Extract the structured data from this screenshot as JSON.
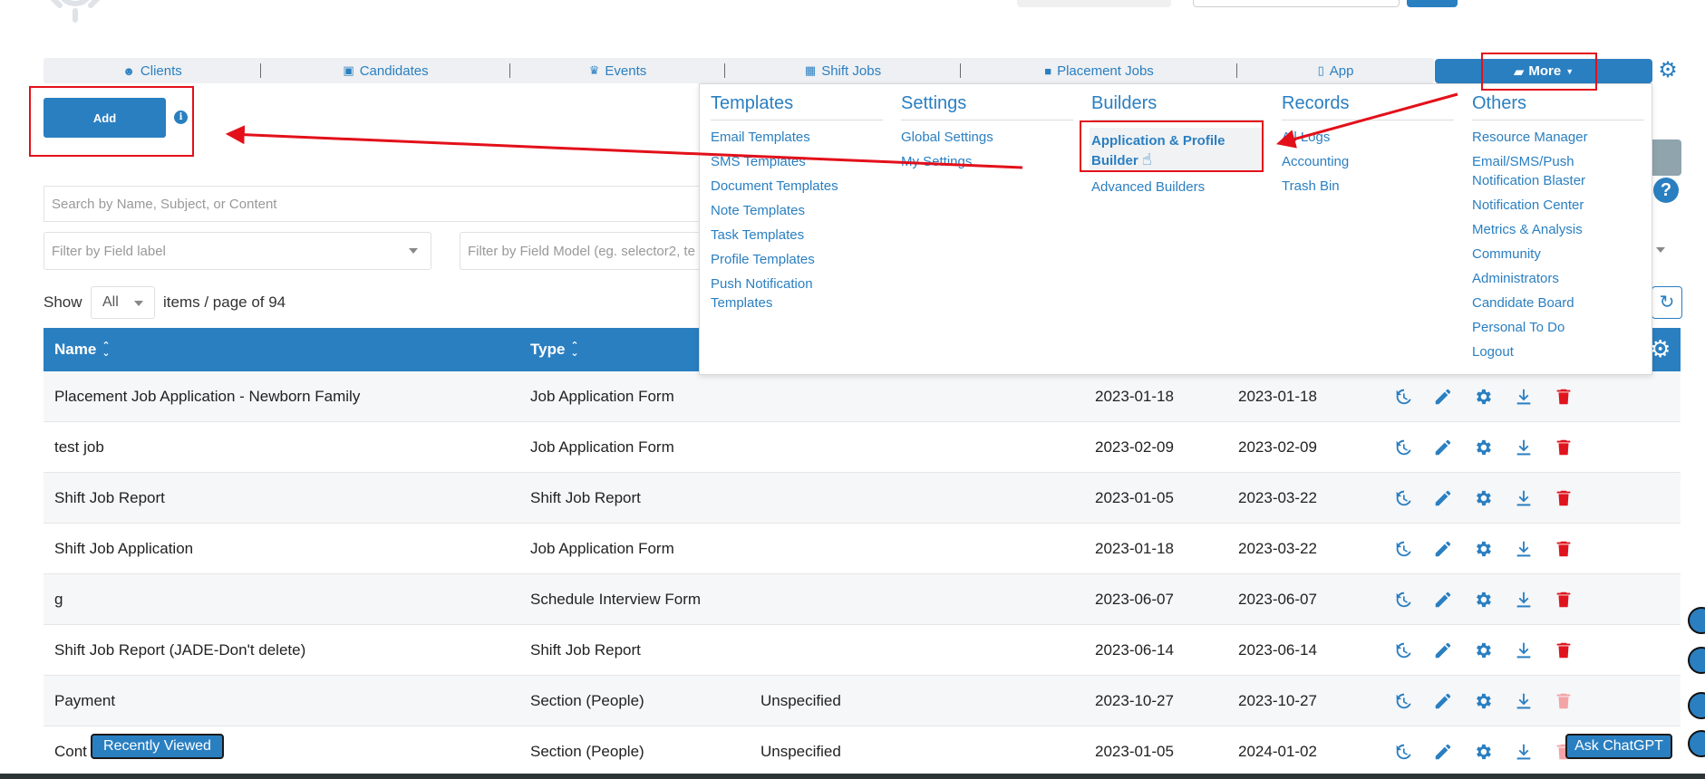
{
  "nav": {
    "items": [
      {
        "label": "Clients",
        "icon": "smile-icon"
      },
      {
        "label": "Candidates",
        "icon": "id-badge-icon"
      },
      {
        "label": "Events",
        "icon": "trophy-icon"
      },
      {
        "label": "Shift Jobs",
        "icon": "calendar-icon"
      },
      {
        "label": "Placement Jobs",
        "icon": "briefcase-icon"
      },
      {
        "label": "App",
        "icon": "mobile-icon"
      }
    ],
    "more_label": "More"
  },
  "toolbar": {
    "add_label": "Add",
    "search_placeholder": "Search by Name, Subject, or Content",
    "filter_label_placeholder": "Filter by Field label",
    "filter_model_placeholder": "Filter by Field Model (eg. selector2, te",
    "show_label": "Show",
    "show_value": "All",
    "items_label": "items / page of 94"
  },
  "menu": {
    "templates": {
      "heading": "Templates",
      "links": [
        "Email Templates",
        "SMS Templates",
        "Document Templates",
        "Note Templates",
        "Task Templates",
        "Profile Templates",
        "Push Notification Templates"
      ]
    },
    "settings": {
      "heading": "Settings",
      "links": [
        "Global Settings",
        "My Settings"
      ]
    },
    "builders": {
      "heading": "Builders",
      "links": [
        "Application & Profile Builder",
        "Advanced Builders"
      ]
    },
    "records": {
      "heading": "Records",
      "links": [
        "All Logs",
        "Accounting",
        "Trash Bin"
      ]
    },
    "others": {
      "heading": "Others",
      "links": [
        "Resource Manager",
        "Email/SMS/Push Notification Blaster",
        "Notification Center",
        "Metrics & Analysis",
        "Community",
        "Administrators",
        "Candidate Board",
        "Personal To Do",
        "Logout"
      ]
    }
  },
  "table": {
    "headers": {
      "name": "Name",
      "type": "Type"
    },
    "rows": [
      {
        "name": "Placement Job Application - Newborn Family",
        "type": "Job Application Form",
        "extra": "",
        "created": "2023-01-18",
        "updated": "2023-01-18",
        "delete_enabled": true
      },
      {
        "name": "test job",
        "type": "Job Application Form",
        "extra": "",
        "created": "2023-02-09",
        "updated": "2023-02-09",
        "delete_enabled": true
      },
      {
        "name": "Shift Job Report",
        "type": "Shift Job Report",
        "extra": "",
        "created": "2023-01-05",
        "updated": "2023-03-22",
        "delete_enabled": true
      },
      {
        "name": "Shift Job Application",
        "type": "Job Application Form",
        "extra": "",
        "created": "2023-01-18",
        "updated": "2023-03-22",
        "delete_enabled": true
      },
      {
        "name": "g",
        "type": "Schedule Interview Form",
        "extra": "",
        "created": "2023-06-07",
        "updated": "2023-06-07",
        "delete_enabled": true
      },
      {
        "name": "Shift Job Report (JADE-Don't delete)",
        "type": "Shift Job Report",
        "extra": "",
        "created": "2023-06-14",
        "updated": "2023-06-14",
        "delete_enabled": true
      },
      {
        "name": "Payment",
        "type": "Section (People)",
        "extra": "Unspecified",
        "created": "2023-10-27",
        "updated": "2023-10-27",
        "delete_enabled": false
      },
      {
        "name": "Cont",
        "type": "Section (People)",
        "extra": "Unspecified",
        "created": "2023-01-05",
        "updated": "2024-01-02",
        "delete_enabled": false
      }
    ]
  },
  "floating": {
    "recently_viewed": "Recently Viewed",
    "ask_chatgpt": "Ask ChatGPT"
  },
  "colors": {
    "primary": "#2a7fc1",
    "danger": "#e0141e",
    "annotation": "#e3101a"
  }
}
